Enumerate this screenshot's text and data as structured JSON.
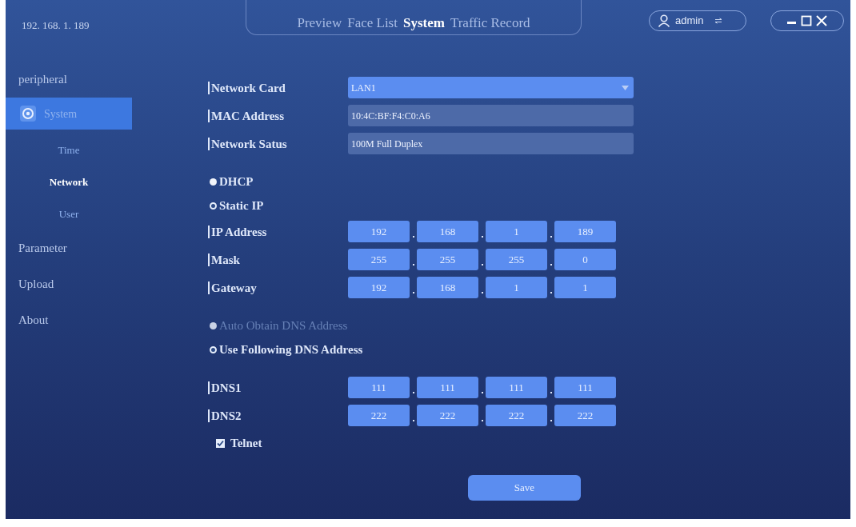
{
  "header": {
    "address": "192. 168. 1. 189",
    "user": "admin"
  },
  "tabs": [
    {
      "label": "Preview",
      "selected": false
    },
    {
      "label": "Face List",
      "selected": false
    },
    {
      "label": "System",
      "selected": true
    },
    {
      "label": "Traffic Record",
      "selected": false
    }
  ],
  "sidebar": {
    "items": [
      {
        "label": "peripheral",
        "selected": false
      },
      {
        "label": "System",
        "selected": true,
        "children": [
          {
            "label": "Time",
            "selected": false
          },
          {
            "label": "Network",
            "selected": true
          },
          {
            "label": "User",
            "selected": false
          }
        ]
      },
      {
        "label": "Parameter",
        "selected": false
      },
      {
        "label": "Upload",
        "selected": false
      },
      {
        "label": "About",
        "selected": false
      }
    ]
  },
  "form": [
    {
      "kind": "dropdown",
      "label": "Network Card",
      "value": "LAN1"
    },
    {
      "kind": "text",
      "label": "MAC Address",
      "value": "10:4C:BF:F4:C0:A6"
    },
    {
      "kind": "text",
      "label": "Network Satus",
      "value": "100M Full Duplex"
    },
    {
      "kind": "gap"
    },
    {
      "kind": "radio",
      "label": "DHCP",
      "selected": false,
      "disabled": false
    },
    {
      "kind": "radio",
      "label": "Static IP",
      "selected": true,
      "disabled": false
    },
    {
      "kind": "ip",
      "label": "IP Address",
      "octets": [
        "192",
        "168",
        "1",
        "189"
      ]
    },
    {
      "kind": "ip",
      "label": "Mask",
      "octets": [
        "255",
        "255",
        "255",
        "0"
      ]
    },
    {
      "kind": "ip",
      "label": "Gateway",
      "octets": [
        "192",
        "168",
        "1",
        "1"
      ]
    },
    {
      "kind": "gap"
    },
    {
      "kind": "radio",
      "label": "Auto Obtain DNS Address",
      "selected": false,
      "disabled": true
    },
    {
      "kind": "radio",
      "label": "Use Following DNS Address",
      "selected": true,
      "disabled": false
    },
    {
      "kind": "gap"
    },
    {
      "kind": "ip",
      "label": "DNS1",
      "octets": [
        "111",
        "111",
        "111",
        "111"
      ]
    },
    {
      "kind": "ip",
      "label": "DNS2",
      "octets": [
        "222",
        "222",
        "222",
        "222"
      ]
    },
    {
      "kind": "checkbox",
      "label": "Telnet",
      "checked": true
    }
  ],
  "save_button": "Save"
}
